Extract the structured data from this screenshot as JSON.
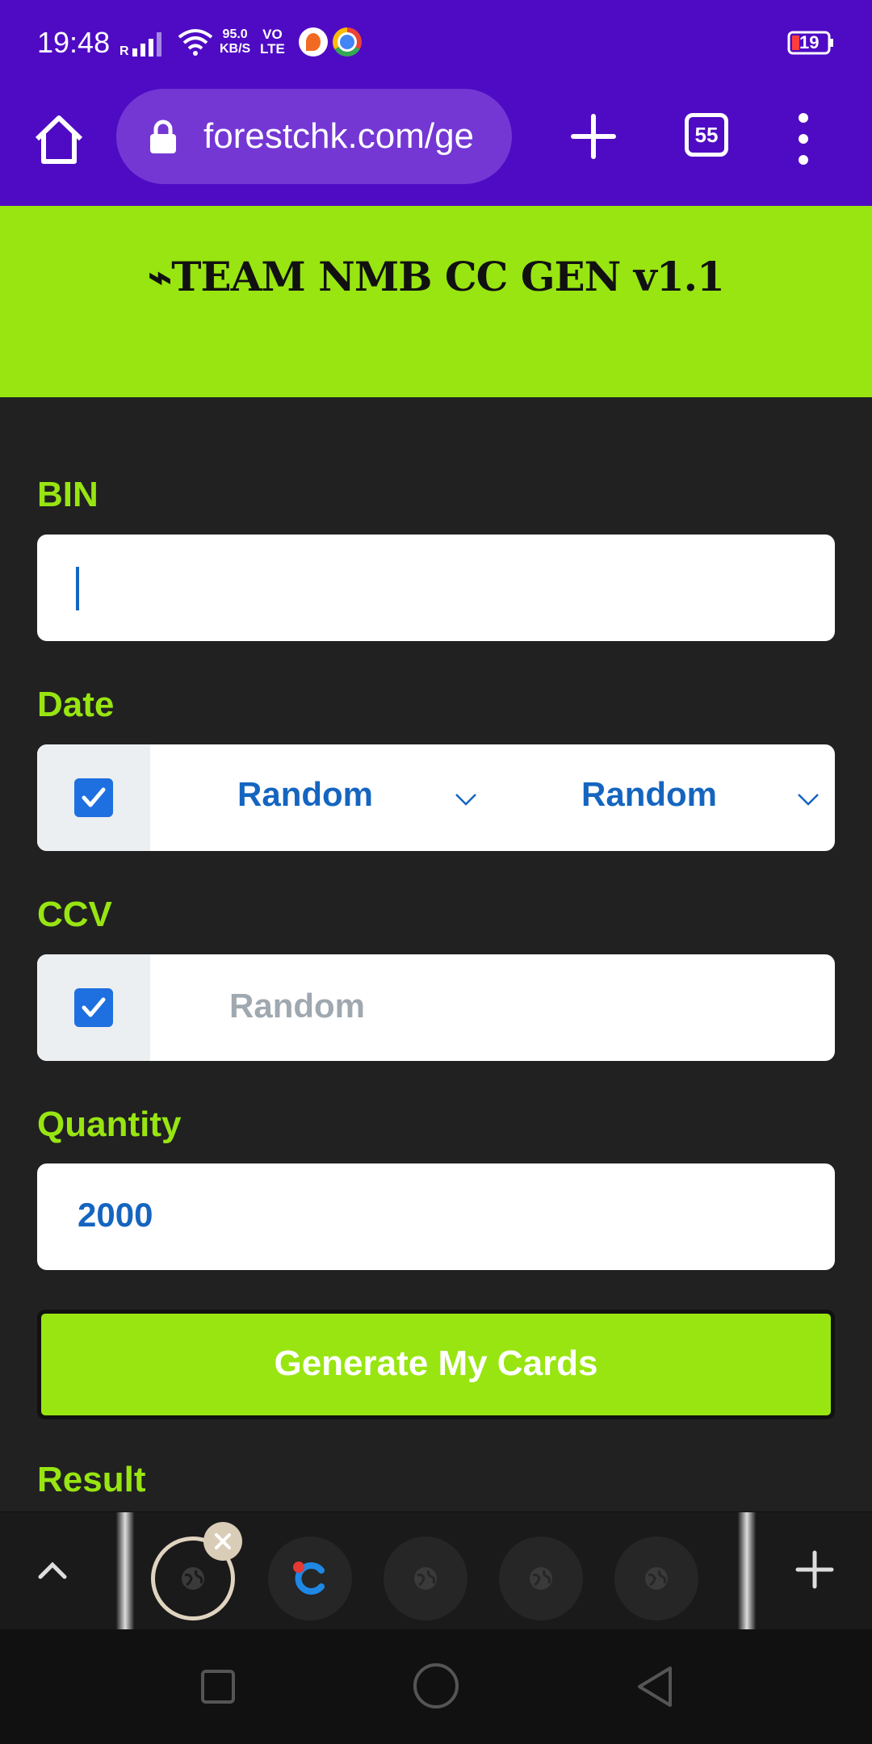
{
  "status_bar": {
    "time": "19:48",
    "net_speed_value": "95.0",
    "net_speed_unit": "KB/S",
    "volte_top": "VO",
    "volte_bottom": "LTE",
    "battery": "19"
  },
  "browser": {
    "url": "forestchk.com/ge",
    "tab_count": "55"
  },
  "page": {
    "title": "⌁TEAM NMB CC GEN v1.1",
    "bin": {
      "label": "BIN",
      "value": ""
    },
    "date": {
      "label": "Date",
      "month": "Random",
      "year": "Random",
      "checked": true
    },
    "ccv": {
      "label": "CCV",
      "placeholder": "Random",
      "checked": true
    },
    "quantity": {
      "label": "Quantity",
      "value": "2000"
    },
    "generate_button": "Generate My Cards",
    "result_label": "Result"
  },
  "colors": {
    "brand_purple": "#4f0bc4",
    "accent_green": "#98e511",
    "link_blue": "#1565c0",
    "background": "#212121"
  }
}
